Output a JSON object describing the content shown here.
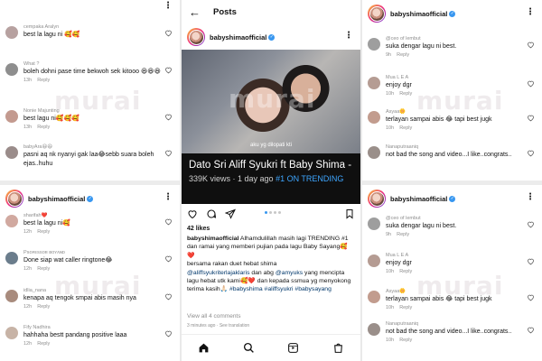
{
  "watermark": "murai",
  "left_top": {
    "comments": [
      {
        "user": "cempaka Aralyn",
        "text": "best la lagu ni 🥰🥰",
        "time": "",
        "reply": "",
        "color": "#b7a1a0"
      },
      {
        "user": "What ?",
        "text": "boleh dohni pase time bekwoh sek kitooo 😆😆😆",
        "time": "13h",
        "reply": "Reply",
        "color": "#8e8e8e"
      },
      {
        "user": "Nonie Majunting",
        "text": "best lagu ni🥰🥰🥰",
        "time": "13h",
        "reply": "Reply",
        "color": "#c39a8f"
      },
      {
        "user": "babyAra😆😆",
        "text": "pasni aq nk nyanyi gak laa😂sebb suara boleh ejas..huhu",
        "time": "",
        "reply": "",
        "color": "#9a8c8a"
      }
    ]
  },
  "left_bottom": {
    "username": "babyshimaofficial",
    "comments": [
      {
        "user": "sharifah❤️",
        "text": "best la lagu ni🥰",
        "time": "12h",
        "reply": "Reply",
        "color": "#d1a9a0"
      },
      {
        "user": "Pꜱᴏꜰᴇꜱꜱᴏʀ ʙᴏʏᴀɴᴅ",
        "text": "Done siap wat caller ringtone😂",
        "time": "12h",
        "reply": "Reply",
        "color": "#6b7d8c"
      },
      {
        "user": "idlia_nana",
        "text": "kenapa aq tengok smpai abis masih nya",
        "time": "12h",
        "reply": "Reply",
        "color": "#a88b7d"
      },
      {
        "user": "Fify Nadhira",
        "text": "hahhaha bestt pandang positive laaa",
        "time": "12h",
        "reply": "Reply",
        "color": "#c7b3a6"
      }
    ]
  },
  "middle": {
    "title": "Posts",
    "username": "babyshimaofficial",
    "video_subtitle": "aku yg dilopati kti",
    "video_title": "Dato Sri Aliff Syukri ft Baby Shima - BABY SAYANG (Official Music Vid...",
    "views": "339K views · 1 day ago",
    "trending": "#1 ON TRENDING",
    "likes": "42 likes",
    "caption_user": "babyshimaofficial",
    "caption_line1": " Alhamdulillah masih lagi TRENDING #1 dan ramai yang memberi pujian pada lagu Baby Sayang🥰❤️",
    "caption_line2": "bersama rakan duet hebat shima",
    "tag1": "@aliffsyukriterlajaklaris",
    "caption_line3": " dan abg ",
    "tag2": "@amyuks",
    "caption_line4": " yang mencipta lagu hebat utk kami🥰❤️ dan kepada ssmua yg menyokong terima kasih🙏🏻 ",
    "tag3": "#babyshima #aliffsyukri #babysayang",
    "view_all": "View all 4 comments",
    "time_ago": "3 minutes ago · See translation"
  },
  "right_top": {
    "username": "babyshimaofficial",
    "comments": [
      {
        "user": "@ceo of lembut",
        "text": "suka dengar lagu ni best.",
        "time": "9h",
        "reply": "Reply",
        "color": "#9e9e9e"
      },
      {
        "user": "Mua L E A",
        "text": "enjoy dgr",
        "time": "10h",
        "reply": "Reply",
        "color": "#b59c93"
      },
      {
        "user": "Asyaa🌼",
        "text": "terlayan sampai abis 😂 tapi best jugk",
        "time": "10h",
        "reply": "Reply",
        "color": "#c29c8e"
      },
      {
        "user": "Nanaputraaniq",
        "text": "not bad the song and video...I like..congrats..",
        "time": "",
        "reply": "",
        "color": "#9a8f8a"
      }
    ]
  },
  "right_bottom": {
    "username": "babyshimaofficial",
    "comments": [
      {
        "user": "@ceo of lembut",
        "text": "suka dengar lagu ni best.",
        "time": "9h",
        "reply": "Reply",
        "color": "#9e9e9e"
      },
      {
        "user": "Mua L E A",
        "text": "enjoy dgr",
        "time": "10h",
        "reply": "Reply",
        "color": "#b59c93"
      },
      {
        "user": "Asyaa🌼",
        "text": "terlayan sampai abis 😂 tapi best jugk",
        "time": "10h",
        "reply": "Reply",
        "color": "#c29c8e"
      },
      {
        "user": "Nanaputraaniq",
        "text": "not bad the song and video...I like..congrats..",
        "time": "10h",
        "reply": "Reply",
        "color": "#9a8f8a"
      }
    ]
  }
}
